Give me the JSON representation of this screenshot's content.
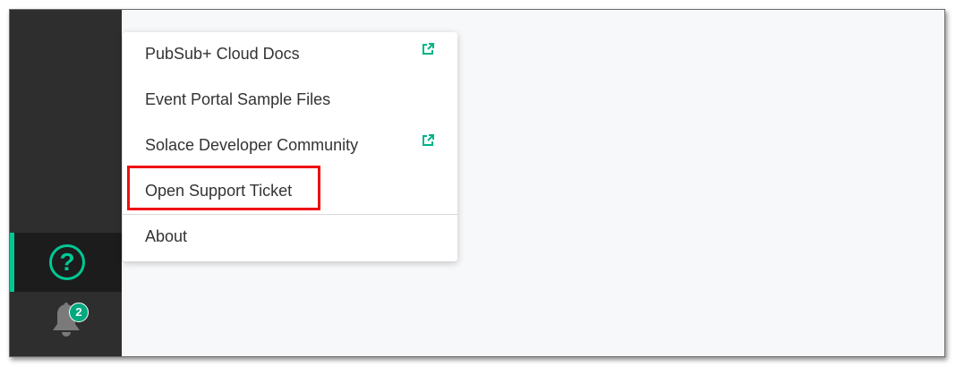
{
  "colors": {
    "sidebar_bg": "#2e2e2e",
    "sidebar_active_bg": "#1c1c1c",
    "accent": "#00c895",
    "badge_bg": "#00a97f",
    "content_bg": "#f7f8fa",
    "highlight": "#ee1111"
  },
  "sidebar": {
    "help": {
      "icon": "help-circle-icon",
      "glyph": "?",
      "active": true
    },
    "notifications": {
      "icon": "bell-icon",
      "badge_count": "2"
    }
  },
  "help_menu": {
    "items": [
      {
        "label": "PubSub+ Cloud Docs",
        "external": true
      },
      {
        "label": "Event Portal Sample Files",
        "external": false
      },
      {
        "label": "Solace Developer Community",
        "external": true
      },
      {
        "label": "Open Support Ticket",
        "external": false,
        "highlighted": true
      },
      {
        "label": "About",
        "external": false
      }
    ]
  }
}
